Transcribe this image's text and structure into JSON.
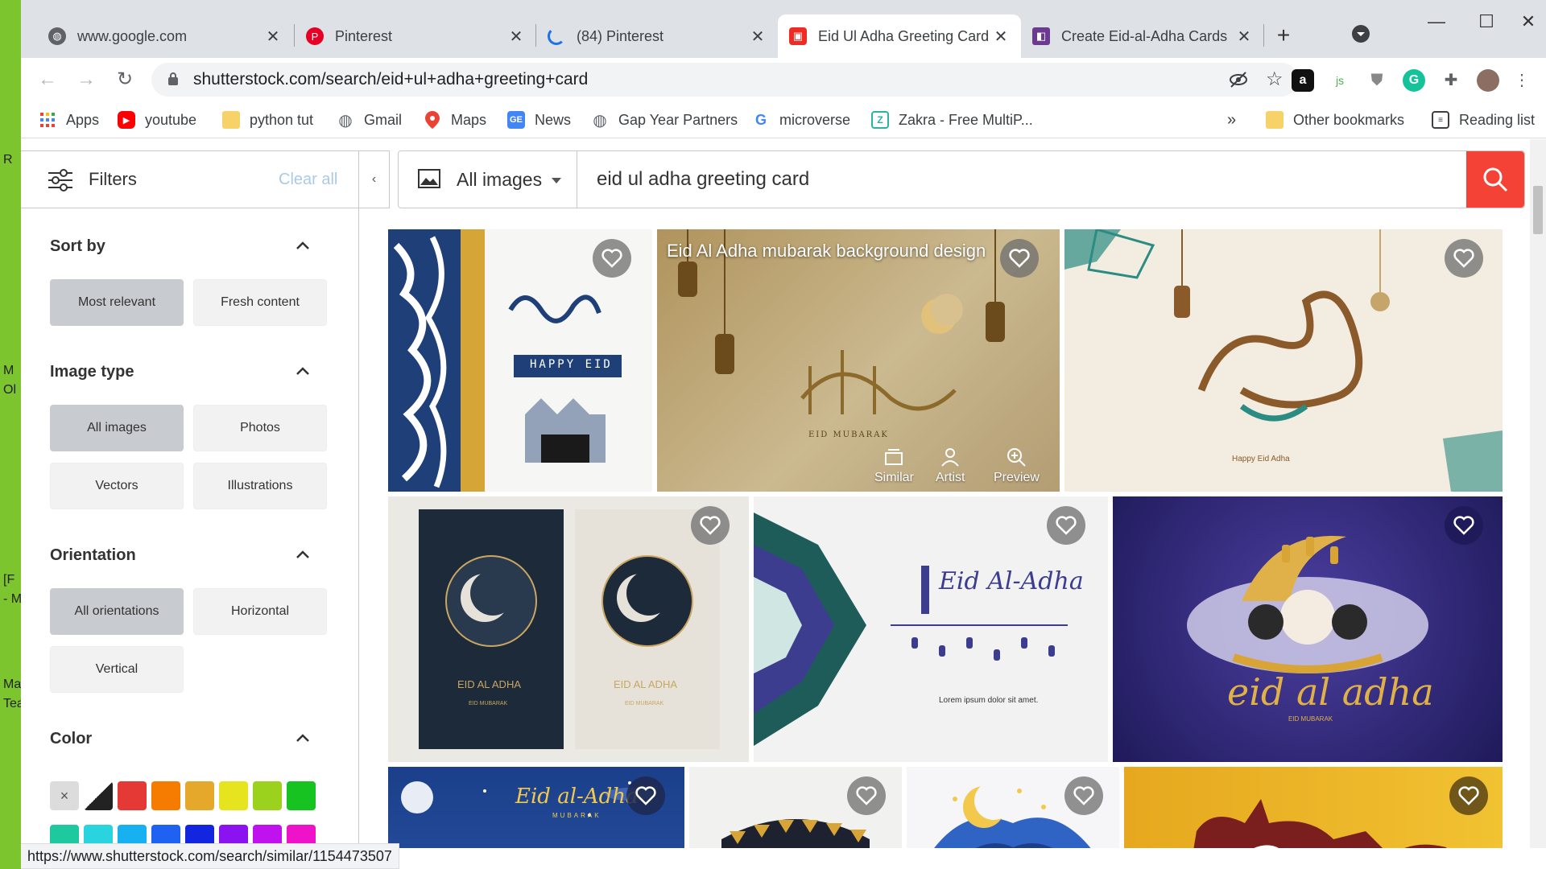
{
  "desktop": {
    "labels": [
      "R",
      "M",
      "Ol",
      "[F",
      "- M",
      "Ma",
      "Tea"
    ]
  },
  "tabs": [
    {
      "title": "www.google.com",
      "favicon": "globe-icon"
    },
    {
      "title": "Pinterest",
      "favicon": "pinterest-icon"
    },
    {
      "title": "(84) Pinterest",
      "favicon": "loading-spinner-icon"
    },
    {
      "title": "Eid Ul Adha Greeting Card",
      "favicon": "shutterstock-icon",
      "active": true
    },
    {
      "title": "Create Eid-al-Adha Cards",
      "favicon": "canva-icon"
    }
  ],
  "address_bar": {
    "url": "shutterstock.com/search/eid+ul+adha+greeting+card"
  },
  "bookmarks": {
    "items": [
      {
        "label": "Apps",
        "icon": "apps-grid-icon"
      },
      {
        "label": "youtube",
        "icon": "youtube-icon"
      },
      {
        "label": "python tut",
        "icon": "folder-icon"
      },
      {
        "label": "Gmail",
        "icon": "globe-icon"
      },
      {
        "label": "Maps",
        "icon": "maps-pin-icon"
      },
      {
        "label": "News",
        "icon": "news-icon"
      },
      {
        "label": "Gap Year Partners",
        "icon": "globe-icon"
      },
      {
        "label": "microverse",
        "icon": "google-icon"
      },
      {
        "label": "Zakra - Free MultiP...",
        "icon": "zakra-icon"
      }
    ],
    "overflow": "»",
    "other_bookmarks": "Other bookmarks",
    "reading_list": "Reading list"
  },
  "filters": {
    "label": "Filters",
    "clear_all": "Clear all",
    "collapse": "‹"
  },
  "search": {
    "image_type": "All images",
    "query": "eid ul adha greeting card"
  },
  "sidebar": {
    "sort_by": {
      "title": "Sort by",
      "options": [
        "Most relevant",
        "Fresh content"
      ],
      "selected": "Most relevant"
    },
    "image_type": {
      "title": "Image type",
      "options": [
        "All images",
        "Photos",
        "Vectors",
        "Illustrations"
      ],
      "selected": "All images"
    },
    "orientation": {
      "title": "Orientation",
      "options": [
        "All orientations",
        "Horizontal",
        "Vertical"
      ],
      "selected": "All orientations"
    },
    "color": {
      "title": "Color",
      "clear_symbol": "×",
      "swatches": [
        "#222222",
        "#e53935",
        "#f57c00",
        "#e6a82a",
        "#e6e31f",
        "#9ad21e",
        "#16c320",
        "#1ec9a0",
        "#2ad4df",
        "#17b1f2",
        "#1f62f2",
        "#1226e0",
        "#8a13ef",
        "#c012ef",
        "#ee12c8"
      ]
    }
  },
  "results": {
    "cards": [
      {
        "id": "card-1",
        "text": "HAPPY EID"
      },
      {
        "id": "card-2",
        "title": "Eid Al Adha mubarak background design",
        "actions": [
          "Similar",
          "Artist",
          "Preview"
        ],
        "text": "EID MUBARAK"
      },
      {
        "id": "card-3",
        "text": "Happy Eid Adha"
      },
      {
        "id": "card-4",
        "text": "EID AL ADHA",
        "subtext": "EID MUBARAK"
      },
      {
        "id": "card-5",
        "text": "Eid Al-Adha",
        "subtext": "Lorem ipsum dolor sit amet."
      },
      {
        "id": "card-6",
        "text": "eid al adha",
        "subtext": "EID MUBARAK"
      },
      {
        "id": "card-7",
        "text": "Eid al-Adha",
        "subtext": "MUBARAK"
      },
      {
        "id": "card-8"
      },
      {
        "id": "card-9"
      },
      {
        "id": "card-10"
      }
    ]
  },
  "status_bar": {
    "url": "https://www.shutterstock.com/search/similar/1154473507"
  },
  "colors": {
    "accent": "#f44336",
    "selected_option": "#c8cbd0",
    "option": "#f2f2f2"
  }
}
